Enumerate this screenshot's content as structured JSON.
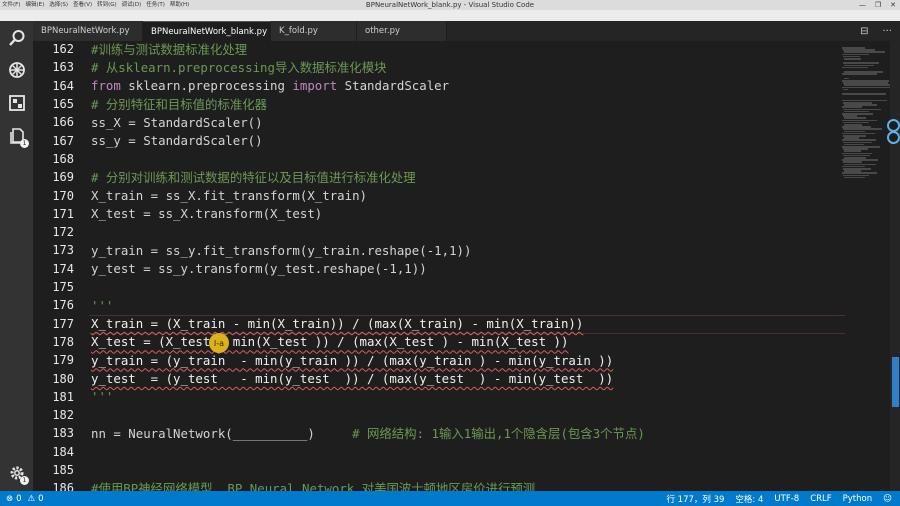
{
  "window": {
    "title": "BPNeuralNetWork_blank.py - Visual Studio Code",
    "menu": [
      "文件(F)",
      "编辑(E)",
      "选择(S)",
      "查看(V)",
      "转到(G)",
      "调试(D)",
      "任务(T)",
      "帮助(H)"
    ],
    "controls": {
      "minimize": "—",
      "maximize": "❐",
      "close": "✕"
    }
  },
  "tabs": [
    {
      "label": "BPNeuralNetWork.py",
      "active": false,
      "closable": false
    },
    {
      "label": "BPNeuralNetWork_blank.py",
      "active": true,
      "closable": true,
      "close_glyph": "●"
    },
    {
      "label": "K_fold.py",
      "active": false,
      "closable": false
    },
    {
      "label": "other.py",
      "active": false,
      "closable": false
    }
  ],
  "tab_actions": {
    "split": "⊟",
    "more": "···"
  },
  "activity": {
    "icons": [
      "search-icon",
      "debug-icon",
      "extensions-icon",
      "explorer-icon",
      "gear-icon"
    ],
    "badges": {
      "explorer": "1",
      "settings": "1"
    }
  },
  "editor": {
    "cursor_marker": "I-a",
    "lines": [
      {
        "n": "162",
        "parts": [
          {
            "t": "#训练与测试数据标准化处理",
            "c": "cmt"
          }
        ]
      },
      {
        "n": "163",
        "parts": [
          {
            "t": "# 从sklearn.preprocessing导入数据标准化模块",
            "c": "cmt"
          }
        ]
      },
      {
        "n": "164",
        "parts": [
          {
            "t": "from",
            "c": "kw"
          },
          {
            "t": " sklearn.preprocessing ",
            "c": ""
          },
          {
            "t": "import",
            "c": "kw"
          },
          {
            "t": " StandardScaler",
            "c": ""
          }
        ]
      },
      {
        "n": "165",
        "parts": [
          {
            "t": "# 分别特征和目标值的标准化器",
            "c": "cmt"
          }
        ]
      },
      {
        "n": "166",
        "parts": [
          {
            "t": "ss_X = StandardScaler()",
            "c": ""
          }
        ]
      },
      {
        "n": "167",
        "parts": [
          {
            "t": "ss_y = StandardScaler()",
            "c": ""
          }
        ]
      },
      {
        "n": "168",
        "parts": []
      },
      {
        "n": "169",
        "parts": [
          {
            "t": "# 分别对训练和测试数据的特征以及目标值进行标准化处理",
            "c": "cmt"
          }
        ]
      },
      {
        "n": "170",
        "parts": [
          {
            "t": "X_train = ss_X.fit_transform(X_train)",
            "c": ""
          }
        ]
      },
      {
        "n": "171",
        "parts": [
          {
            "t": "X_test = ss_X.transform(X_test)",
            "c": ""
          }
        ]
      },
      {
        "n": "172",
        "parts": []
      },
      {
        "n": "173",
        "parts": [
          {
            "t": "y_train = ss_y.fit_transform(y_train.reshape(-1,1))",
            "c": ""
          }
        ]
      },
      {
        "n": "174",
        "parts": [
          {
            "t": "y_test = ss_y.transform(y_test.reshape(-1,1))",
            "c": ""
          }
        ]
      },
      {
        "n": "175",
        "parts": []
      },
      {
        "n": "176",
        "parts": [
          {
            "t": "'''",
            "c": "cmt"
          }
        ]
      },
      {
        "n": "177",
        "parts": [
          {
            "t": "X_train = (X_train - min(X_train)) / (max(X_train) - min(X_train))",
            "c": "err"
          }
        ]
      },
      {
        "n": "178",
        "parts": [
          {
            "t": "X_test = (X_test - min(X_test )) / (max(X_test ) - min(X_test ))",
            "c": "err"
          }
        ]
      },
      {
        "n": "179",
        "parts": [
          {
            "t": "y_train = (y_train  - min(y_train )) / (max(y_train ) - min(y_train ))",
            "c": "err"
          }
        ]
      },
      {
        "n": "180",
        "parts": [
          {
            "t": "y_test  = (y_test   - min(y_test  )) / (max(y_test  ) - min(y_test  ))",
            "c": "err"
          }
        ]
      },
      {
        "n": "181",
        "parts": [
          {
            "t": "'''",
            "c": "cmt"
          }
        ]
      },
      {
        "n": "182",
        "parts": []
      },
      {
        "n": "183",
        "parts": [
          {
            "t": "nn = NeuralNetwork(__________)",
            "c": ""
          },
          {
            "t": "     # 网络结构: 1输入1输出,1个隐含层(包含3个节点)",
            "c": "cmt"
          }
        ]
      },
      {
        "n": "184",
        "parts": []
      },
      {
        "n": "185",
        "parts": []
      },
      {
        "n": "186",
        "parts": [
          {
            "t": "#使用BP神经网络模型  BP_Neural_Network 对美国波士顿地区房价进行预测",
            "c": "cmt"
          }
        ]
      }
    ]
  },
  "statusbar": {
    "errors": "0",
    "warnings": "0",
    "position": "行 177，列 39",
    "spaces": "空格: 4",
    "encoding": "UTF-8",
    "eol": "CRLF",
    "language": "Python",
    "feedback": "☺"
  },
  "colors": {
    "statusbar": "#007acc",
    "comment": "#6a9955",
    "keyword": "#c586c0",
    "error_squiggle": "#e05a5a"
  }
}
